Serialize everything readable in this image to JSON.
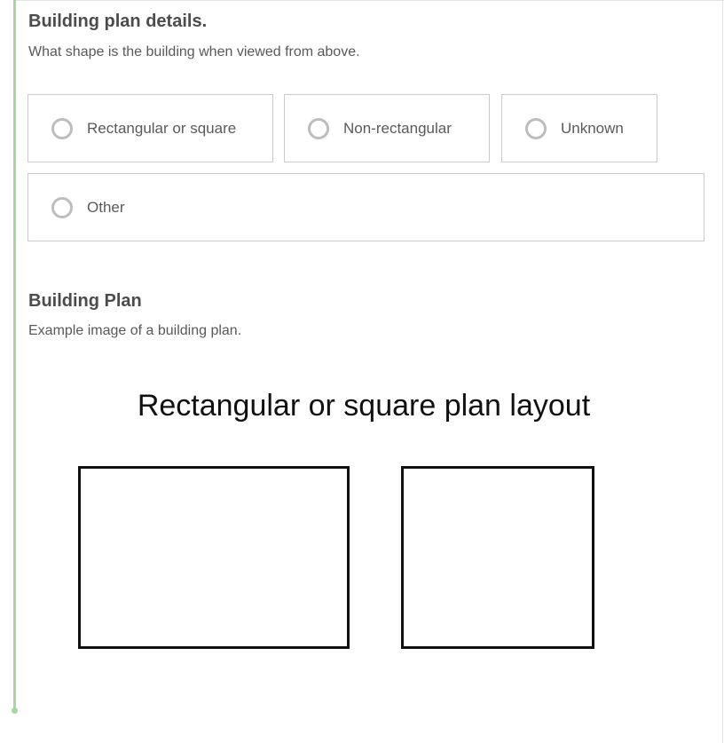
{
  "question": {
    "title": "Building plan details.",
    "description": "What shape is the building when viewed from above."
  },
  "options": [
    {
      "label": "Rectangular or square",
      "selected": false
    },
    {
      "label": "Non-rectangular",
      "selected": false
    },
    {
      "label": "Unknown",
      "selected": false
    },
    {
      "label": "Other",
      "selected": false
    }
  ],
  "plan_section": {
    "title": "Building Plan",
    "description": "Example image of a building plan."
  },
  "plan_image": {
    "caption": "Rectangular or square  plan layout",
    "shapes": [
      "rectangle",
      "square"
    ]
  },
  "colors": {
    "rail": "#a8d5a2",
    "border": "#cacaca",
    "radio": "#bdbdbd"
  }
}
